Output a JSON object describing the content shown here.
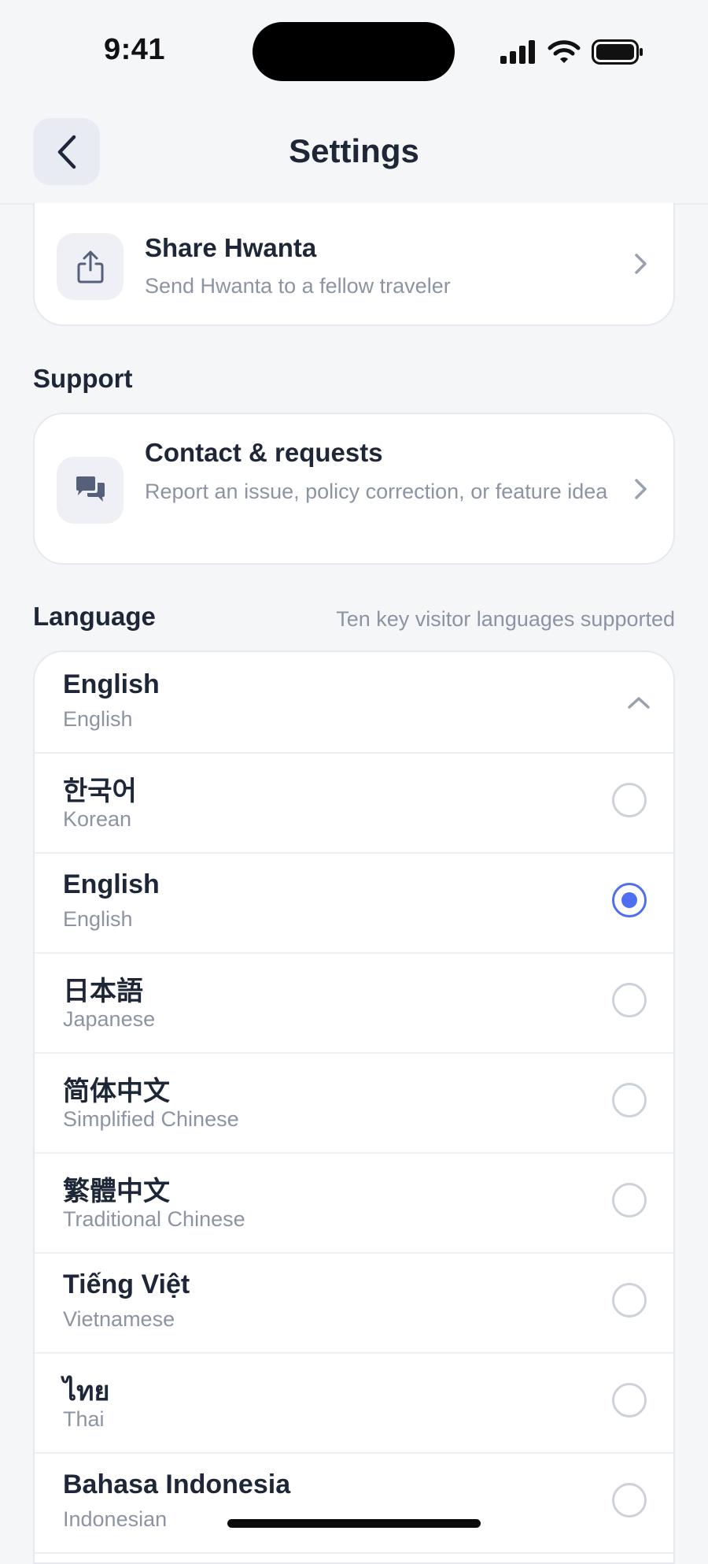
{
  "status_bar": {
    "time": "9:41"
  },
  "nav": {
    "title": "Settings",
    "back_icon": "chevron-left-icon"
  },
  "share": {
    "title": "Share Hwanta",
    "subtitle": "Send Hwanta to a fellow traveler",
    "icon": "share-icon"
  },
  "support": {
    "section_label": "Support",
    "contact": {
      "title": "Contact & requests",
      "subtitle": "Report an issue, policy correction, or feature idea",
      "icon": "chat-bubbles-icon"
    }
  },
  "language": {
    "section_label": "Language",
    "note": "Ten key visitor languages supported",
    "current": {
      "native": "English",
      "english": "English"
    },
    "options": [
      {
        "native": "한국어",
        "english": "Korean",
        "selected": false
      },
      {
        "native": "English",
        "english": "English",
        "selected": true
      },
      {
        "native": "日本語",
        "english": "Japanese",
        "selected": false
      },
      {
        "native": "简体中文",
        "english": "Simplified Chinese",
        "selected": false
      },
      {
        "native": "繁體中文",
        "english": "Traditional Chinese",
        "selected": false
      },
      {
        "native": "Tiếng Việt",
        "english": "Vietnamese",
        "selected": false
      },
      {
        "native": "ไทย",
        "english": "Thai",
        "selected": false
      },
      {
        "native": "Bahasa Indonesia",
        "english": "Indonesian",
        "selected": false
      }
    ]
  },
  "colors": {
    "accent": "#4F6EF0",
    "text": "#1E2738",
    "muted": "#8C94A3",
    "background": "#F5F6F8"
  }
}
